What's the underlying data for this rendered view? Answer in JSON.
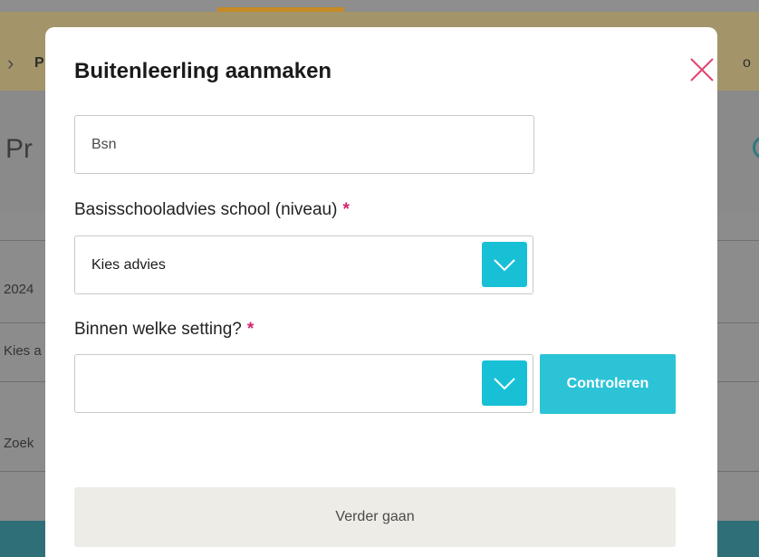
{
  "background": {
    "breadcrumb_partial": "P",
    "breadcrumb_right_partial": "o",
    "page_title_partial": "Pr",
    "list_cells": [
      "2024",
      "Kies a",
      "Zoek"
    ]
  },
  "modal": {
    "title": "Buitenleerling aanmaken",
    "bsn": {
      "placeholder": "Bsn",
      "value": ""
    },
    "advies": {
      "label": "Basisschooladvies school (niveau)",
      "required_mark": "*",
      "selected": "Kies advies"
    },
    "setting": {
      "label": "Binnen welke setting?",
      "required_mark": "*",
      "selected": ""
    },
    "check_button": "Controleren",
    "next_button": "Verder gaan"
  },
  "colors": {
    "accent_cyan": "#18c0d6",
    "required_pink": "#d0246f",
    "close_icon_pink": "#e2456f",
    "button_disabled_bg": "#eeece6"
  },
  "icons": {
    "close": "close-icon",
    "dropdown": "chevron-down-icon",
    "breadcrumb": "chevron-right-icon"
  }
}
